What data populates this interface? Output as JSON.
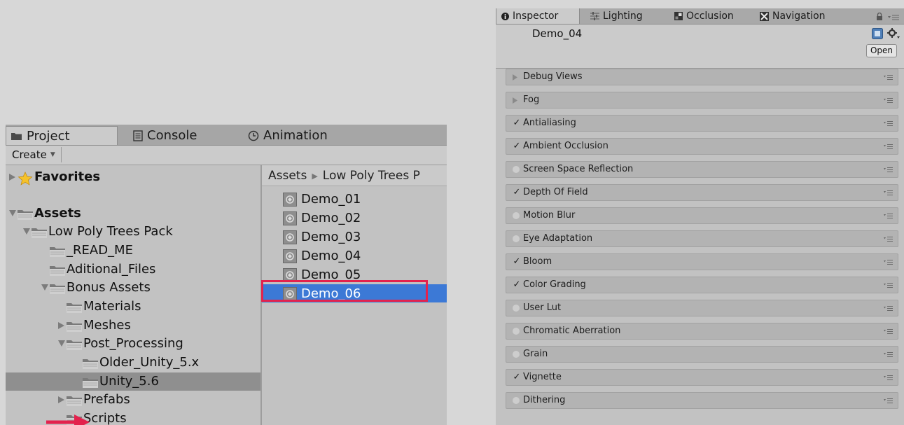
{
  "project_window": {
    "tabs": [
      {
        "label": "Project",
        "icon": "folder-icon",
        "active": true
      },
      {
        "label": "Console",
        "icon": "console-icon",
        "active": false
      },
      {
        "label": "Animation",
        "icon": "clock-icon",
        "active": false
      }
    ],
    "create_label": "Create",
    "tree": [
      {
        "label": "Favorites",
        "bold": true,
        "depth": 0,
        "arrow": "right",
        "icon": "star-folder-icon"
      },
      {
        "label": "Assets",
        "bold": true,
        "depth": 0,
        "arrow": "down",
        "icon": "folder-icon"
      },
      {
        "label": "Low Poly Trees Pack",
        "bold": false,
        "depth": 1,
        "arrow": "down",
        "icon": "folder-icon"
      },
      {
        "label": "_READ_ME",
        "bold": false,
        "depth": 2,
        "arrow": "none",
        "icon": "folder-icon"
      },
      {
        "label": "Aditional_Files",
        "bold": false,
        "depth": 2,
        "arrow": "none",
        "icon": "folder-icon"
      },
      {
        "label": "Bonus Assets",
        "bold": false,
        "depth": 2,
        "arrow": "down",
        "icon": "folder-icon"
      },
      {
        "label": "Materials",
        "bold": false,
        "depth": 3,
        "arrow": "none",
        "icon": "folder-icon"
      },
      {
        "label": "Meshes",
        "bold": false,
        "depth": 3,
        "arrow": "right",
        "icon": "folder-icon"
      },
      {
        "label": "Post_Processing",
        "bold": false,
        "depth": 3,
        "arrow": "down",
        "icon": "folder-icon"
      },
      {
        "label": "Older_Unity_5.x",
        "bold": false,
        "depth": 4,
        "arrow": "none",
        "icon": "folder-icon"
      },
      {
        "label": "Unity_5.6",
        "bold": false,
        "depth": 4,
        "arrow": "none",
        "icon": "folder-icon",
        "selected": true
      },
      {
        "label": "Prefabs",
        "bold": false,
        "depth": 3,
        "arrow": "right",
        "icon": "folder-icon"
      },
      {
        "label": "Scripts",
        "bold": false,
        "depth": 3,
        "arrow": "none",
        "icon": "folder-icon"
      }
    ],
    "breadcrumb": [
      "Assets",
      "Low Poly Trees P"
    ],
    "assets": [
      {
        "label": "Demo_01",
        "selected": false
      },
      {
        "label": "Demo_02",
        "selected": false
      },
      {
        "label": "Demo_03",
        "selected": false
      },
      {
        "label": "Demo_04",
        "selected": false
      },
      {
        "label": "Demo_05",
        "selected": false
      },
      {
        "label": "Demo_06",
        "selected": true
      }
    ]
  },
  "inspector": {
    "tabs": [
      {
        "label": "Inspector",
        "icon": "info-icon",
        "active": true
      },
      {
        "label": "Lighting",
        "icon": "lighting-icon",
        "active": false
      },
      {
        "label": "Occlusion",
        "icon": "occlusion-icon",
        "active": false
      },
      {
        "label": "Navigation",
        "icon": "navigation-icon",
        "active": false
      }
    ],
    "object_name": "Demo_04",
    "open_label": "Open",
    "effects": [
      {
        "label": "Debug Views",
        "state": "collapsed"
      },
      {
        "label": "Fog",
        "state": "collapsed"
      },
      {
        "label": "Antialiasing",
        "state": "enabled"
      },
      {
        "label": "Ambient Occlusion",
        "state": "enabled"
      },
      {
        "label": "Screen Space Reflection",
        "state": "disabled"
      },
      {
        "label": "Depth Of Field",
        "state": "enabled"
      },
      {
        "label": "Motion Blur",
        "state": "disabled"
      },
      {
        "label": "Eye Adaptation",
        "state": "disabled"
      },
      {
        "label": "Bloom",
        "state": "enabled"
      },
      {
        "label": "Color Grading",
        "state": "enabled"
      },
      {
        "label": "User Lut",
        "state": "disabled"
      },
      {
        "label": "Chromatic Aberration",
        "state": "disabled"
      },
      {
        "label": "Grain",
        "state": "disabled"
      },
      {
        "label": "Vignette",
        "state": "enabled"
      },
      {
        "label": "Dithering",
        "state": "disabled"
      }
    ],
    "checkmark_glyph": "✓"
  },
  "colors": {
    "selection_blue": "#3c79d6",
    "highlight_red": "#e3224d",
    "panel_gray": "#c2c2c2"
  }
}
